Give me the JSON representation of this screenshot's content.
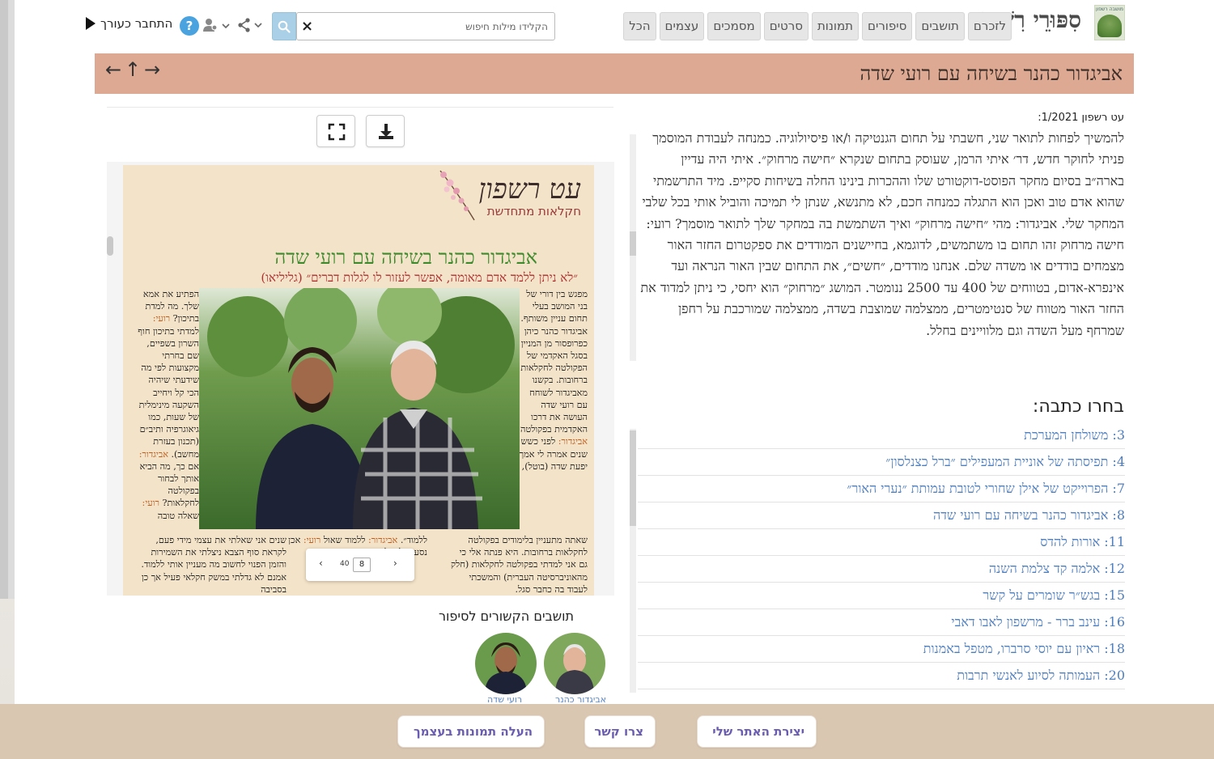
{
  "header": {
    "site_title": "סִפּוּרֵי רִשְׁפּוֹן",
    "logo_text": "מושבה רשפון",
    "nav": [
      "לזכרם",
      "תושבים",
      "סיפורים",
      "תמונות",
      "סרטים",
      "מסמכים",
      "עצמים",
      "הכל"
    ],
    "search_placeholder": "הקלידו מילות חיפוש",
    "search_value": "",
    "clear_label": "×",
    "help_label": "?",
    "login_label": "התחבר כעורך"
  },
  "title_band": {
    "title": "אביגדור כהנר בשיחה עם רועי שדה",
    "arrows": [
      "←",
      "↑",
      "→"
    ]
  },
  "newspaper": {
    "brand": "עט רשפון",
    "brand_sub": "חקלאות מתחדשת",
    "headline": "אביגדור כהנר בשיחה עם רועי שדה",
    "subhead": "״לא ניתן ללמד אדם מאומה, אפשר לעזור לו לגלות דברים״ (גליליאו)",
    "col_right": "מפגש בין דורי של בני המושב בעלי תחום עניין משותף. אביגדור כהנר כיהן כפרופסור מן המניין בסגל האקדמי של הפקולטה לחקלאות ברחובות. בקשנו מאביגדור לשוחח עם רועי שדה העושה את דרכו האקדמית בפקולטה.",
    "col_right_speaker": "אביגדור:",
    "col_right_2": "לפני כשש שנים אמרה לי אמך, יפעת שדה (בוטל),",
    "col_left_1": "הפתיע את אמא שלך. מה למדת בתיכון?",
    "col_left_speaker": "רועי:",
    "col_left_2": "למדתי בתיכון חוף השרון בשפיים, שם בחרתי מקצועות לפי מה שידעתי שיהיה הכי קל ויחייב השקעה מינימלית של שעות, כמו גיאוגרפיה ותיב״ם (תכנון בעזרת מחשב).",
    "col_left_speaker2": "אביגדור:",
    "col_left_3": "אם כך, מה הביא אותך לבחור בפקולטה לחקלאות?",
    "col_left_speaker3": "רועי:",
    "col_left_4": "שאלה טובה",
    "bottom_right": "שאתה מתעניין בלימודים בפקולטה לחקלאות ברחובות. היא פנתה אלי כי גם אני למדתי בפקולטה לחקלאות (חלק מהאוניברסיטה העברית) והמשכתי לעבוד בה כחבר סגל.",
    "bottom_mid_1": "ללמוד״.",
    "bottom_mid_speaker": "אביגדור:",
    "bottom_mid_2": "ללמוד שאול",
    "bottom_mid_speaker2": "רועי:",
    "bottom_mid_3": "אכן נסעתי לטיול נוסף במזרח",
    "bottom_left": "שנים אני שאלתי את עצמי מידי פעם, לקראת סוף הצבא ניצלתי את השמירות והזמן הפנוי לחשוב מה מעניין אותי ללמוד. אמנם לא גדלתי במשק חקלאי פעיל אך כן בסביבה",
    "pager_prev": "‹",
    "pager_current": "8",
    "pager_total": "40",
    "pager_next": "›"
  },
  "related": {
    "title": "תושבים הקשורים לסיפור",
    "people": [
      {
        "name": "אביגדור כהנר"
      },
      {
        "name": "רועי שדה"
      }
    ]
  },
  "article": {
    "meta": "עט רשפון 1/2021:",
    "body": "להמשיך לפחות לתואר שני, חשבתי על תחום הגנטיקה ו/או פיסיולוגיה. כמנחה לעבודת המוסמך פניתי לחוקר חדש, דר׳ איתי הרמן, שעוסק בתחום שנקרא ״חישה מרחוק״. איתי היה עדיין בארה״ב בסיום מחקר הפוסט-דוקטורט שלו וההכרות בינינו החלה בשיחות סקייפ. מיד התרשמתי שהוא אדם טוב ואכן הוא התגלה כמנחה חכם, לא מתנשא, שנתן לי תמיכה והוביל אותי בכל שלבי המחקר שלי. אביגדור: מהי ״חישה מרחוק״ ואיך השתמשת בה במחקר שלך לתואר מוסמך? רועי: חישה מרחוק זהו תחום בו משתמשים, לדוגמא, בחיישנים המודדים את ספקטרום החזר האור מצמחים בודדים או משדה שלם. אנחנו מודדים, ״חשים״, את התחום שבין האור הנראה ועד אינפרא-אדום, בטווחים של 400 עד 2500 ננומטר. המושג ״מרחוק״ הוא יחסי, כי ניתן למדוד את החזר האור מטווח של סנטימטרים, ממצלמה שמוצבת בשדה, ממצלמה שמורכבת על רחפן שמרחף מעל השדה וגם מלוויינים בחלל."
  },
  "articles": {
    "title": "בחרו כתבה:",
    "items": [
      "3: משולחן המערכת",
      "4: תפיסתה של אוניית המעפילים ״ברל כצנלסון״",
      "7: הפרוייקט של אילן שחורי לטובת עמותת ״נערי האור״",
      "8: אביגדור כהנר בשיחה עם רועי שדה",
      "11: אורות להדס",
      "12: אלמה קד צלמת השנה",
      "15: בגש״ר שומרים על קשר",
      "16: עינב ברר - מרשפון לאבו דאבי",
      "18: ראיון עם יוסי סרברו, מטפל באמנות",
      "20: העמותה לסיוע לאנשי תרבות"
    ]
  },
  "footer": {
    "create_site": "יצירת האתר שלי",
    "contact": "צרו קשר",
    "upload_photo": "העלה תמונות בעצמך"
  },
  "colors": {
    "title_band": "#dea992",
    "footer": "#d9c7b2",
    "link": "#4d7ec0",
    "footer_button_text": "#6a5cb0",
    "headline_green": "#3d8a2c",
    "subhead_red": "#b12f2f"
  }
}
